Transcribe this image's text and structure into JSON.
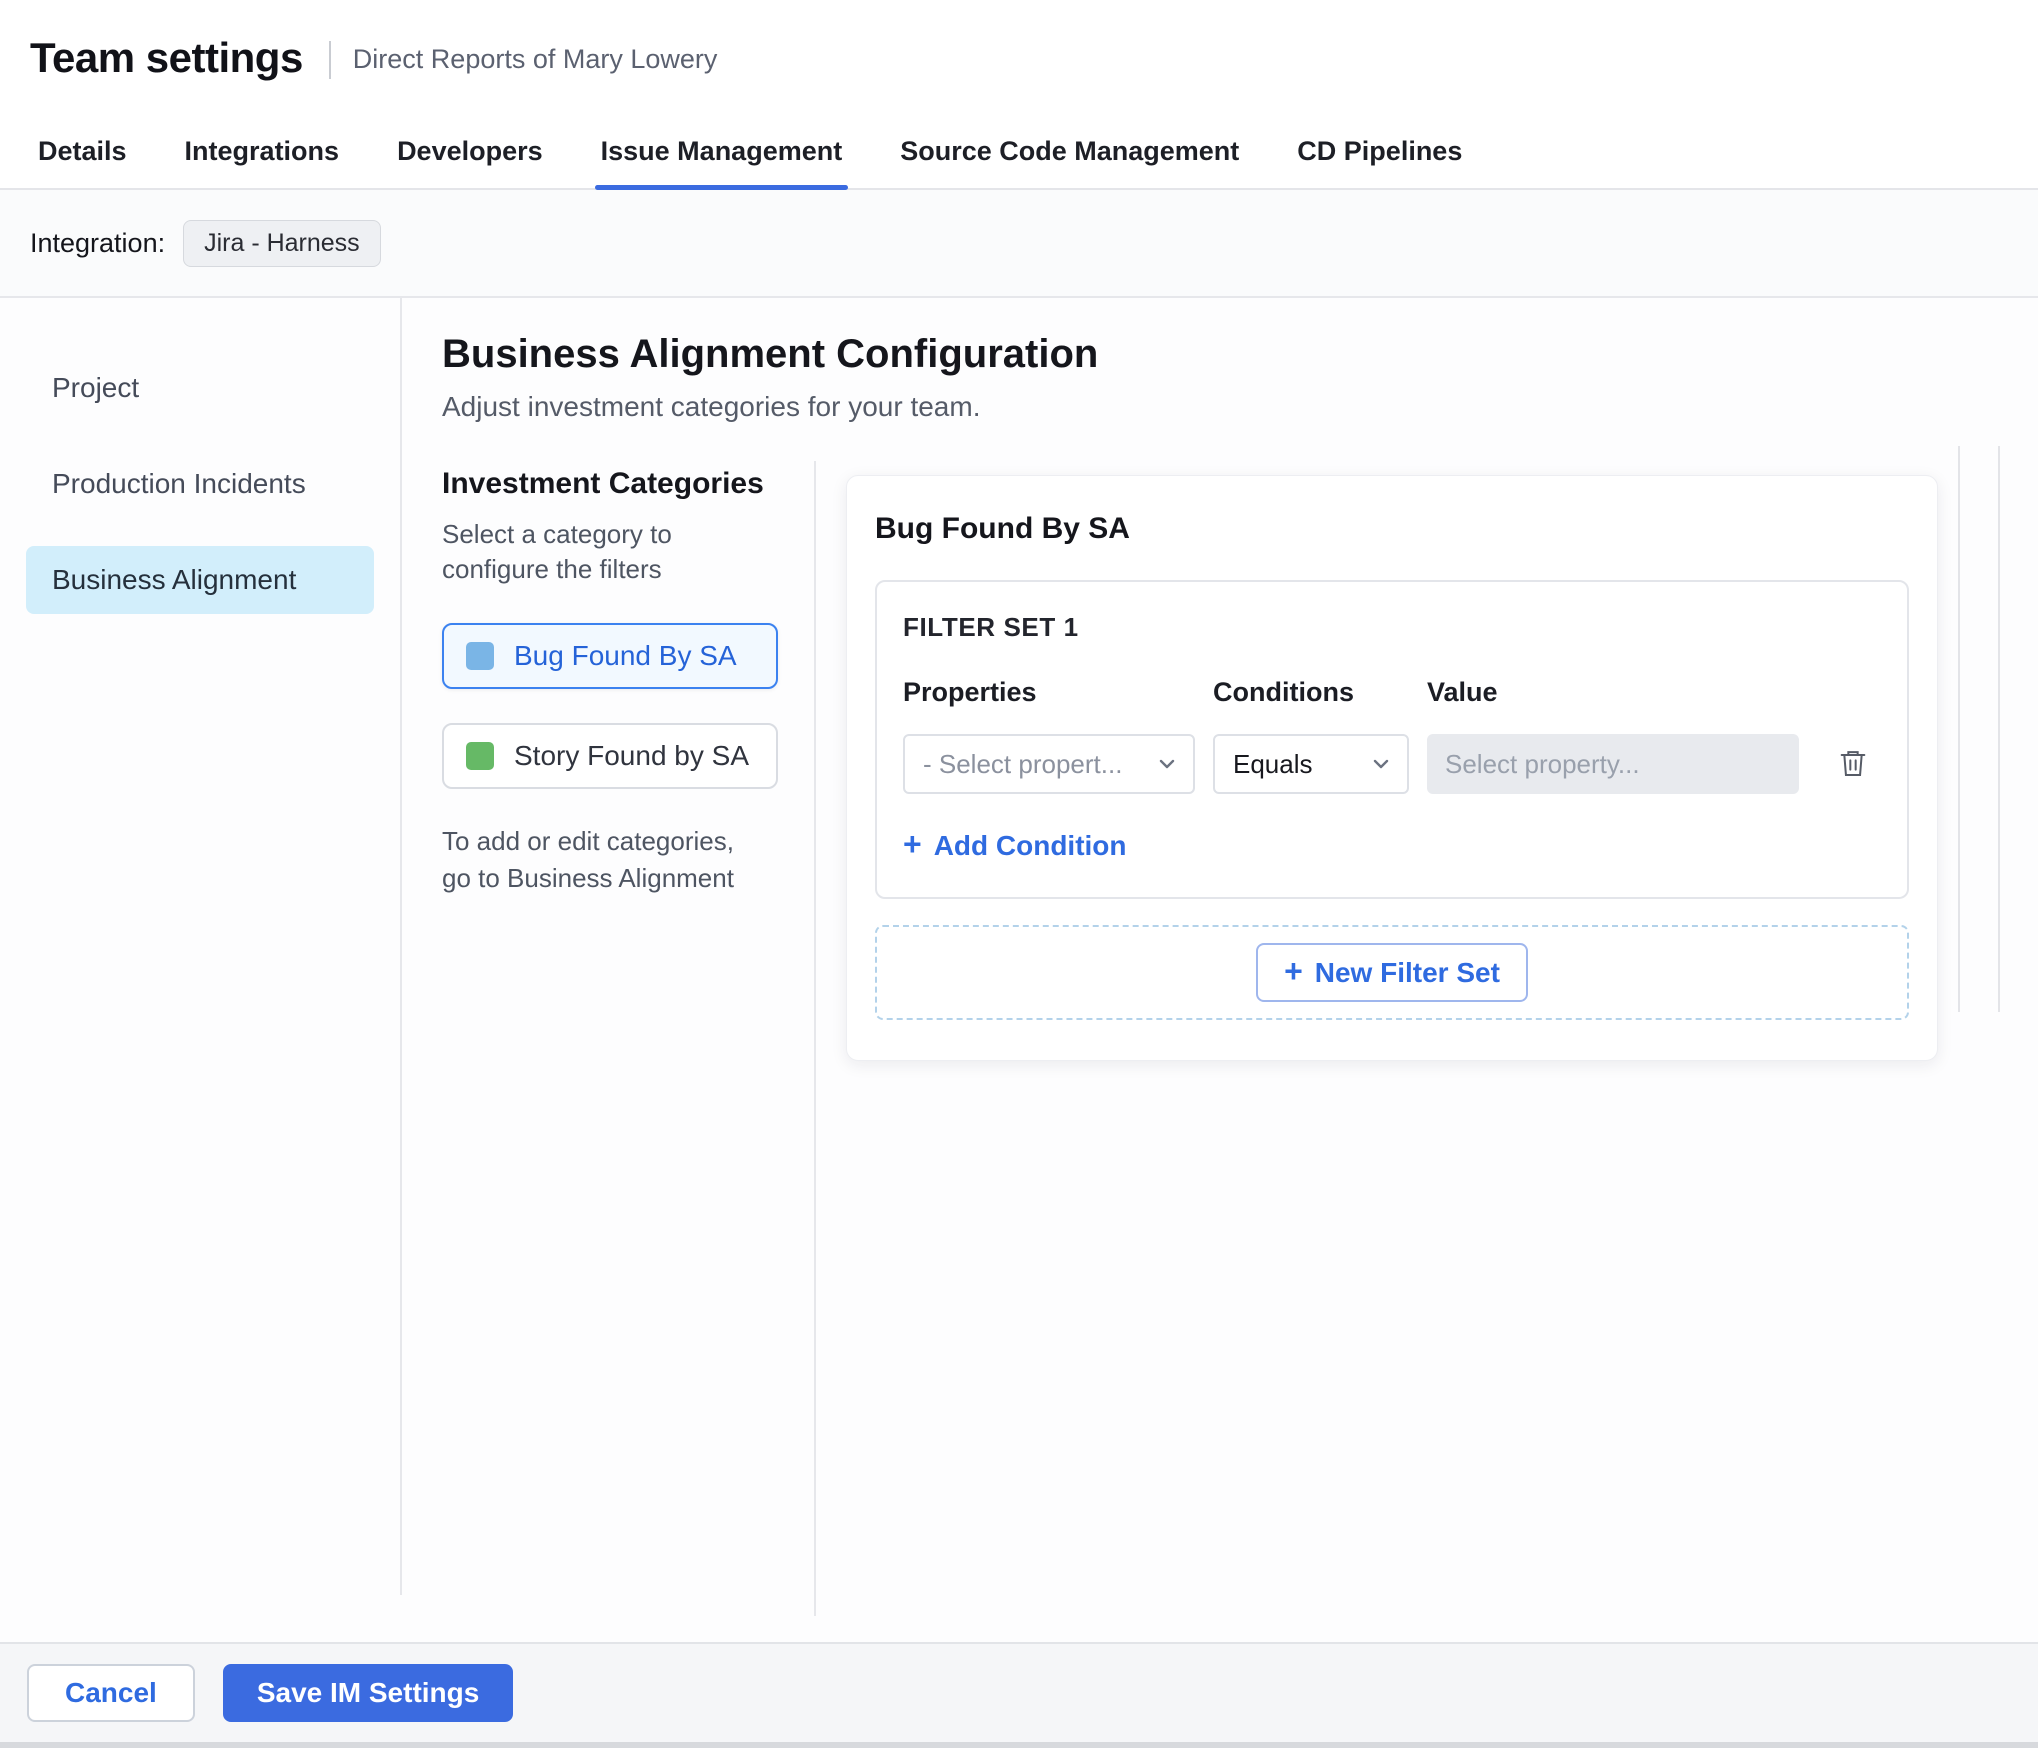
{
  "header": {
    "title": "Team settings",
    "subtitle": "Direct Reports of Mary Lowery"
  },
  "tabs": [
    {
      "label": "Details",
      "active": false
    },
    {
      "label": "Integrations",
      "active": false
    },
    {
      "label": "Developers",
      "active": false
    },
    {
      "label": "Issue Management",
      "active": true
    },
    {
      "label": "Source Code Management",
      "active": false
    },
    {
      "label": "CD Pipelines",
      "active": false
    }
  ],
  "integration": {
    "label": "Integration:",
    "chip": "Jira - Harness"
  },
  "sidebar": {
    "items": [
      {
        "label": "Project",
        "active": false
      },
      {
        "label": "Production Incidents",
        "active": false
      },
      {
        "label": "Business Alignment",
        "active": true
      }
    ]
  },
  "main": {
    "title": "Business Alignment Configuration",
    "subtitle": "Adjust investment categories for your team.",
    "categories": {
      "title": "Investment Categories",
      "helper": "Select a category to configure the filters",
      "items": [
        {
          "label": "Bug Found By SA",
          "color": "#7ab5e6",
          "selected": true
        },
        {
          "label": "Story Found by SA",
          "color": "#66b966",
          "selected": false
        }
      ],
      "footnote": "To add or edit categories, go to Business Alignment"
    },
    "panel": {
      "title": "Bug Found By SA",
      "filter_set": {
        "title": "FILTER SET 1",
        "columns": [
          "Properties",
          "Conditions",
          "Value"
        ],
        "property_value": "- Select propert...",
        "condition_value": "Equals",
        "value_placeholder": "Select property...",
        "add_condition_label": "Add Condition"
      },
      "new_filter_set_label": "New Filter Set"
    }
  },
  "footer": {
    "cancel_label": "Cancel",
    "save_label": "Save IM Settings"
  },
  "icons": {
    "plus": "+"
  },
  "colors": {
    "primary": "#3b6be0",
    "active_tab_underline": "#3b6be0",
    "sidebar_selected_bg": "#d2eefb",
    "category_blue_swatch": "#7ab5e6",
    "category_green_swatch": "#66b966",
    "disabled_input_bg": "#e8eaee"
  }
}
